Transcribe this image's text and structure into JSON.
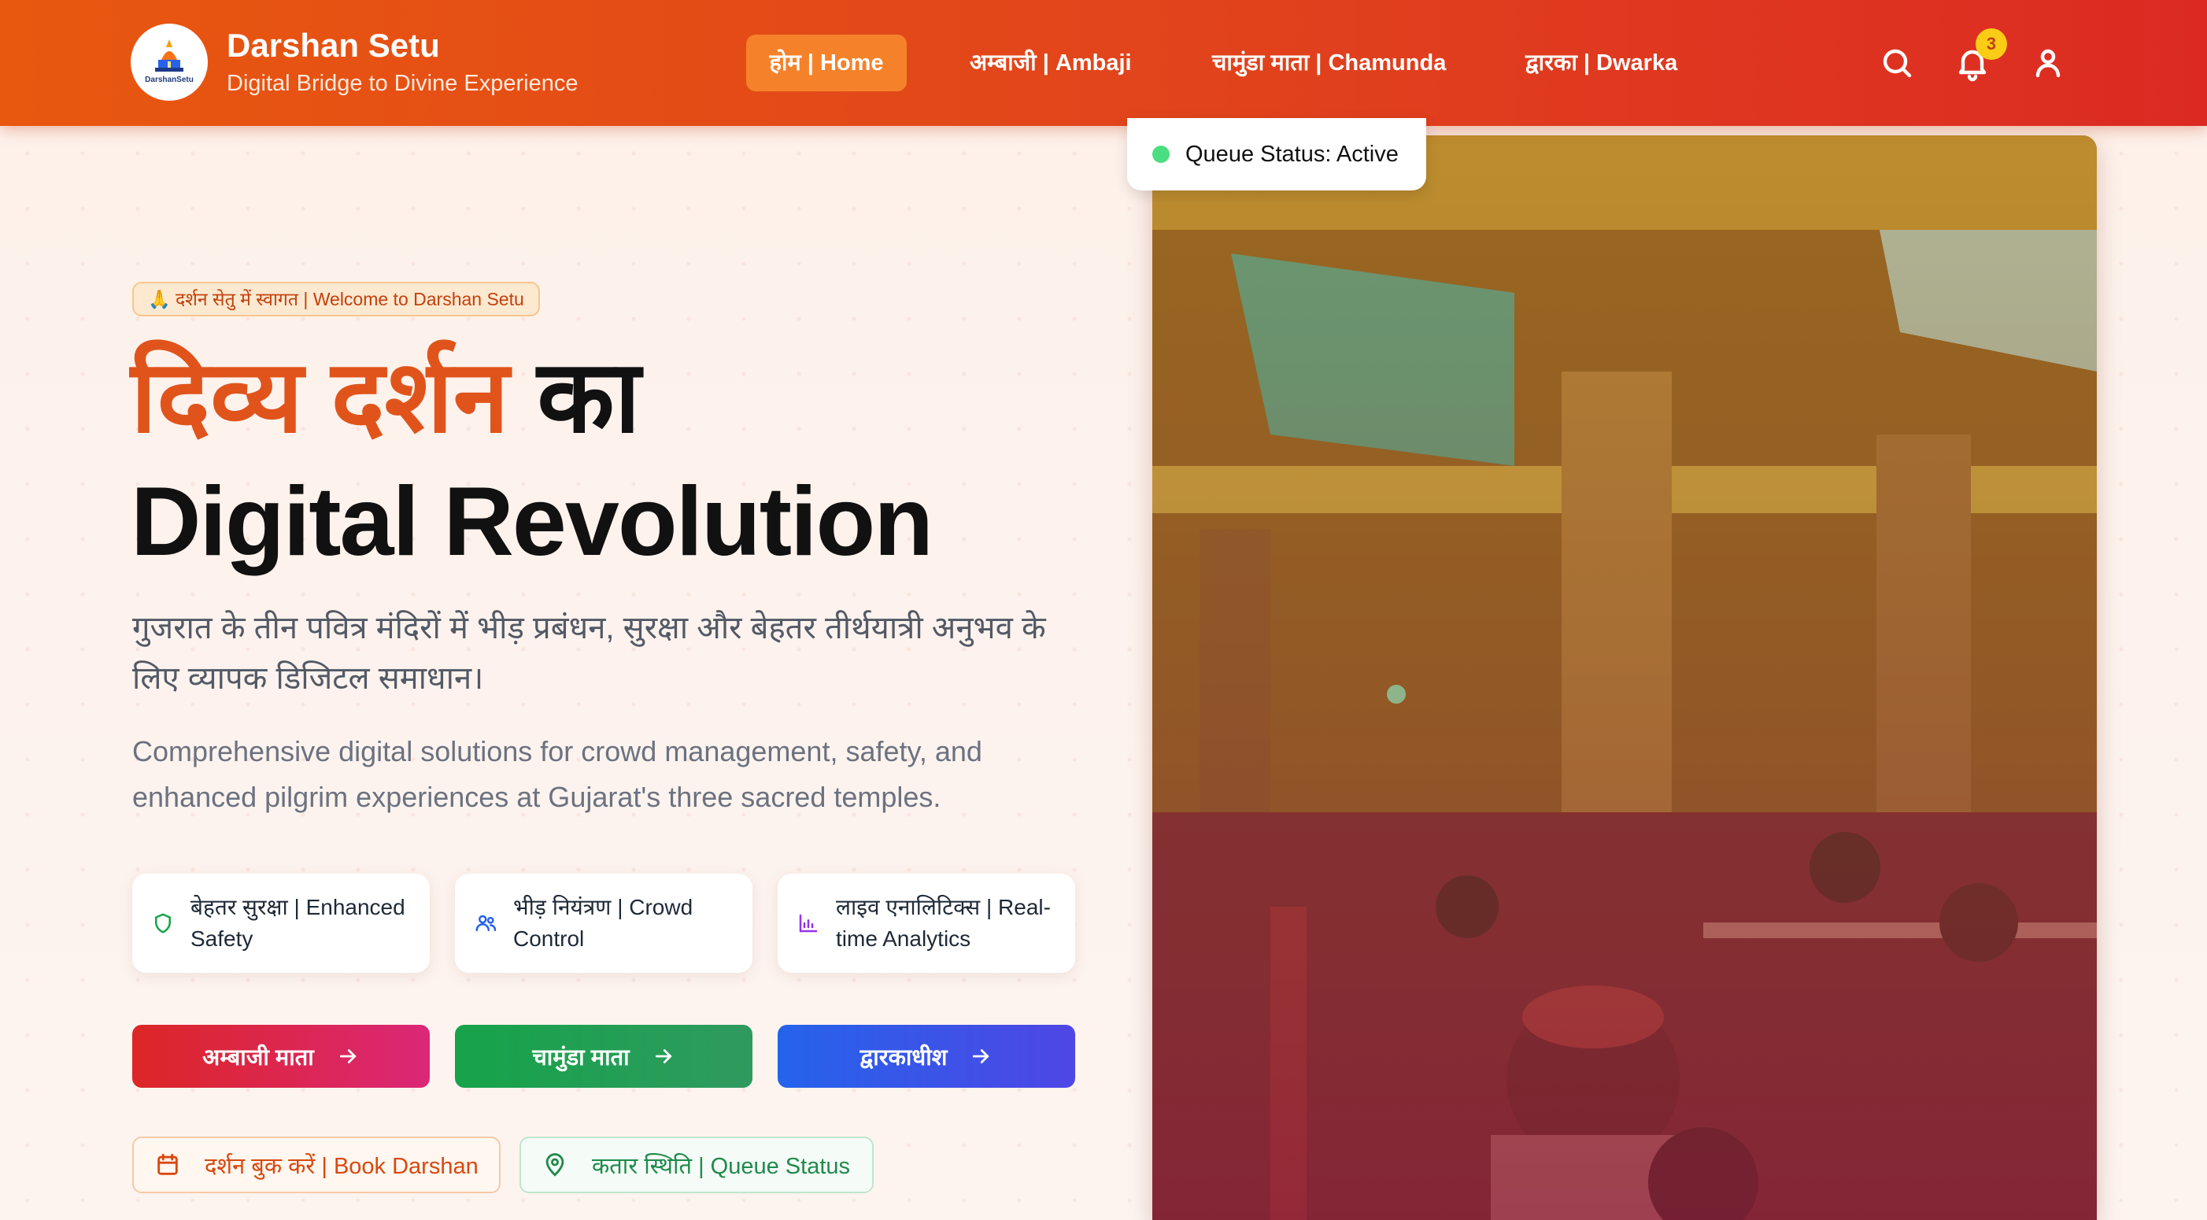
{
  "header": {
    "logo_text": "DarshanSetu",
    "brand_title": "Darshan Setu",
    "brand_subtitle": "Digital Bridge to Divine Experience",
    "nav": {
      "home": "होम | Home",
      "ambaji": "अम्बाजी | Ambaji",
      "chamunda": "चामुंडा माता | Chamunda",
      "dwarka": "द्वारका | Dwarka"
    },
    "notification_count": "3",
    "icons": [
      "search-icon",
      "bell-icon",
      "user-icon"
    ]
  },
  "hero": {
    "welcome": "🙏 दर्शन सेतु में स्वागत | Welcome to Darshan Setu",
    "title_accent": "दिव्य दर्शन",
    "title_rest": " का",
    "title_line2": "Digital Revolution",
    "description_hi": "गुजरात के तीन पवित्र मंदिरों में भीड़ प्रबंधन, सुरक्षा और बेहतर तीर्थयात्री अनुभव के लिए व्यापक डिजिटल समाधान।",
    "description_en": "Comprehensive digital solutions for crowd management, safety, and enhanced pilgrim experiences at Gujarat's three sacred temples.",
    "features": [
      {
        "label": "बेहतर सुरक्षा | Enhanced Safety",
        "icon": "shield-icon",
        "color": "#16a34a"
      },
      {
        "label": "भीड़ नियंत्रण | Crowd Control",
        "icon": "users-icon",
        "color": "#2563eb"
      },
      {
        "label": "लाइव एनालिटिक्स | Real-time Analytics",
        "icon": "bar-chart-icon",
        "color": "#9333ea"
      }
    ],
    "temple_buttons": [
      {
        "label": "अम्बाजी माता",
        "color": "#dc2626"
      },
      {
        "label": "चामुंडा माता",
        "color": "#16a34a"
      },
      {
        "label": "द्वारकाधीश",
        "color": "#2563eb"
      }
    ],
    "secondary_buttons": {
      "book": "दर्शन बुक करें | Book Darshan",
      "queue": "कतार स्थिति | Queue Status"
    }
  },
  "queue_status": {
    "label": "Queue Status: Active",
    "indicator_color": "#4ade80"
  },
  "colors": {
    "header_start": "#e8580f",
    "header_end": "#dc2a23",
    "accent": "#e0541c"
  }
}
